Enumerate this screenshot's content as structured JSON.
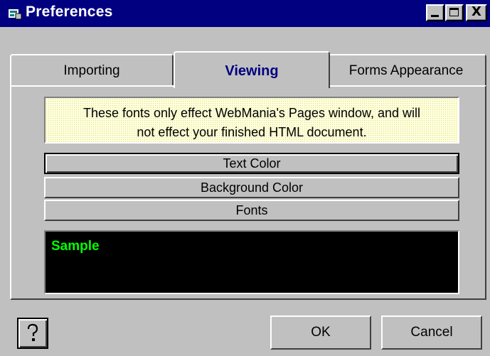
{
  "window": {
    "title": "Preferences",
    "icon": "app-icon"
  },
  "titlebar_buttons": {
    "close_label": "X"
  },
  "tabs": [
    {
      "label": "Importing"
    },
    {
      "label": "Viewing",
      "active": true
    },
    {
      "label": "Forms Appearance"
    }
  ],
  "notice": {
    "line1": "These fonts only effect WebMania's Pages window, and will",
    "line2": "not effect your finished HTML document."
  },
  "options": {
    "text_color": "Text Color",
    "background_color": "Background Color",
    "fonts": "Fonts"
  },
  "sample": {
    "text": "Sample",
    "text_color": "#00ff00",
    "background": "#000000"
  },
  "footer": {
    "help_icon": "help-icon",
    "ok_label": "OK",
    "cancel_label": "Cancel"
  },
  "colors": {
    "titlebar": "#000080",
    "face": "#c0c0c0",
    "notice_bg": "#ffffd8"
  }
}
